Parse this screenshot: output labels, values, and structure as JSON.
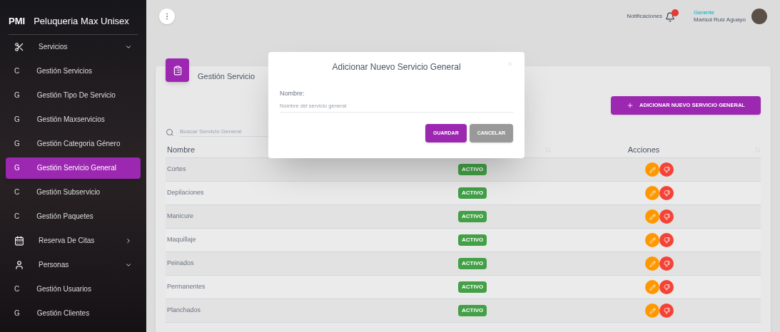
{
  "sidebar": {
    "logo": "PMI",
    "title": "Peluqueria Max Unisex",
    "groups": [
      {
        "label": "Servicios",
        "kind": "scissors",
        "expanded": true,
        "children": [
          {
            "abbr": "C",
            "label": "Gestión Servicios",
            "selected": false
          },
          {
            "abbr": "G",
            "label": "Gestión Tipo De Servicio",
            "selected": false
          },
          {
            "abbr": "G",
            "label": "Gestión Maxservicios",
            "selected": false
          },
          {
            "abbr": "G",
            "label": "Gestión Categoria Género",
            "selected": false
          },
          {
            "abbr": "G",
            "label": "Gestión Servicio General",
            "selected": true
          },
          {
            "abbr": "C",
            "label": "Gestión Subservicio",
            "selected": false
          },
          {
            "abbr": "C",
            "label": "Gestión Paquetes",
            "selected": false
          }
        ]
      },
      {
        "label": "Reserva De Citas",
        "kind": "calendar",
        "expanded": false
      },
      {
        "label": "Personas",
        "kind": "person",
        "expanded": true,
        "children": [
          {
            "abbr": "C",
            "label": "Gestión Usuarios",
            "selected": false
          },
          {
            "abbr": "G",
            "label": "Gestión Clientes",
            "selected": false
          }
        ]
      }
    ]
  },
  "topbar": {
    "notifications": "Notificaciones",
    "role": "Gerente",
    "user": "Marisol Ruiz Aguayo"
  },
  "card": {
    "title": "Gestión Servicio",
    "add_button": "ADICIONAR NUEVO SERVICIO GENERAL",
    "search": {
      "placeholder": "Buscar Servicio General"
    },
    "table": {
      "columns": [
        "Nombre",
        "Acciones"
      ],
      "rows": [
        {
          "name": "Cortes",
          "status": "ACTIVO"
        },
        {
          "name": "Depilaciones",
          "status": "ACTIVO"
        },
        {
          "name": "Manicure",
          "status": "ACTIVO"
        },
        {
          "name": "Maquillaje",
          "status": "ACTIVO"
        },
        {
          "name": "Peinados",
          "status": "ACTIVO"
        },
        {
          "name": "Permanentes",
          "status": "ACTIVO"
        },
        {
          "name": "Planchados",
          "status": "ACTIVO"
        }
      ]
    }
  },
  "dialog": {
    "title": "Adicionar Nuevo Servicio General",
    "field_label": "Nombre:",
    "field": {
      "placeholder": "Nombre del servicio general"
    },
    "buttons": [
      "GUARDAR",
      "CANCELAR"
    ]
  }
}
